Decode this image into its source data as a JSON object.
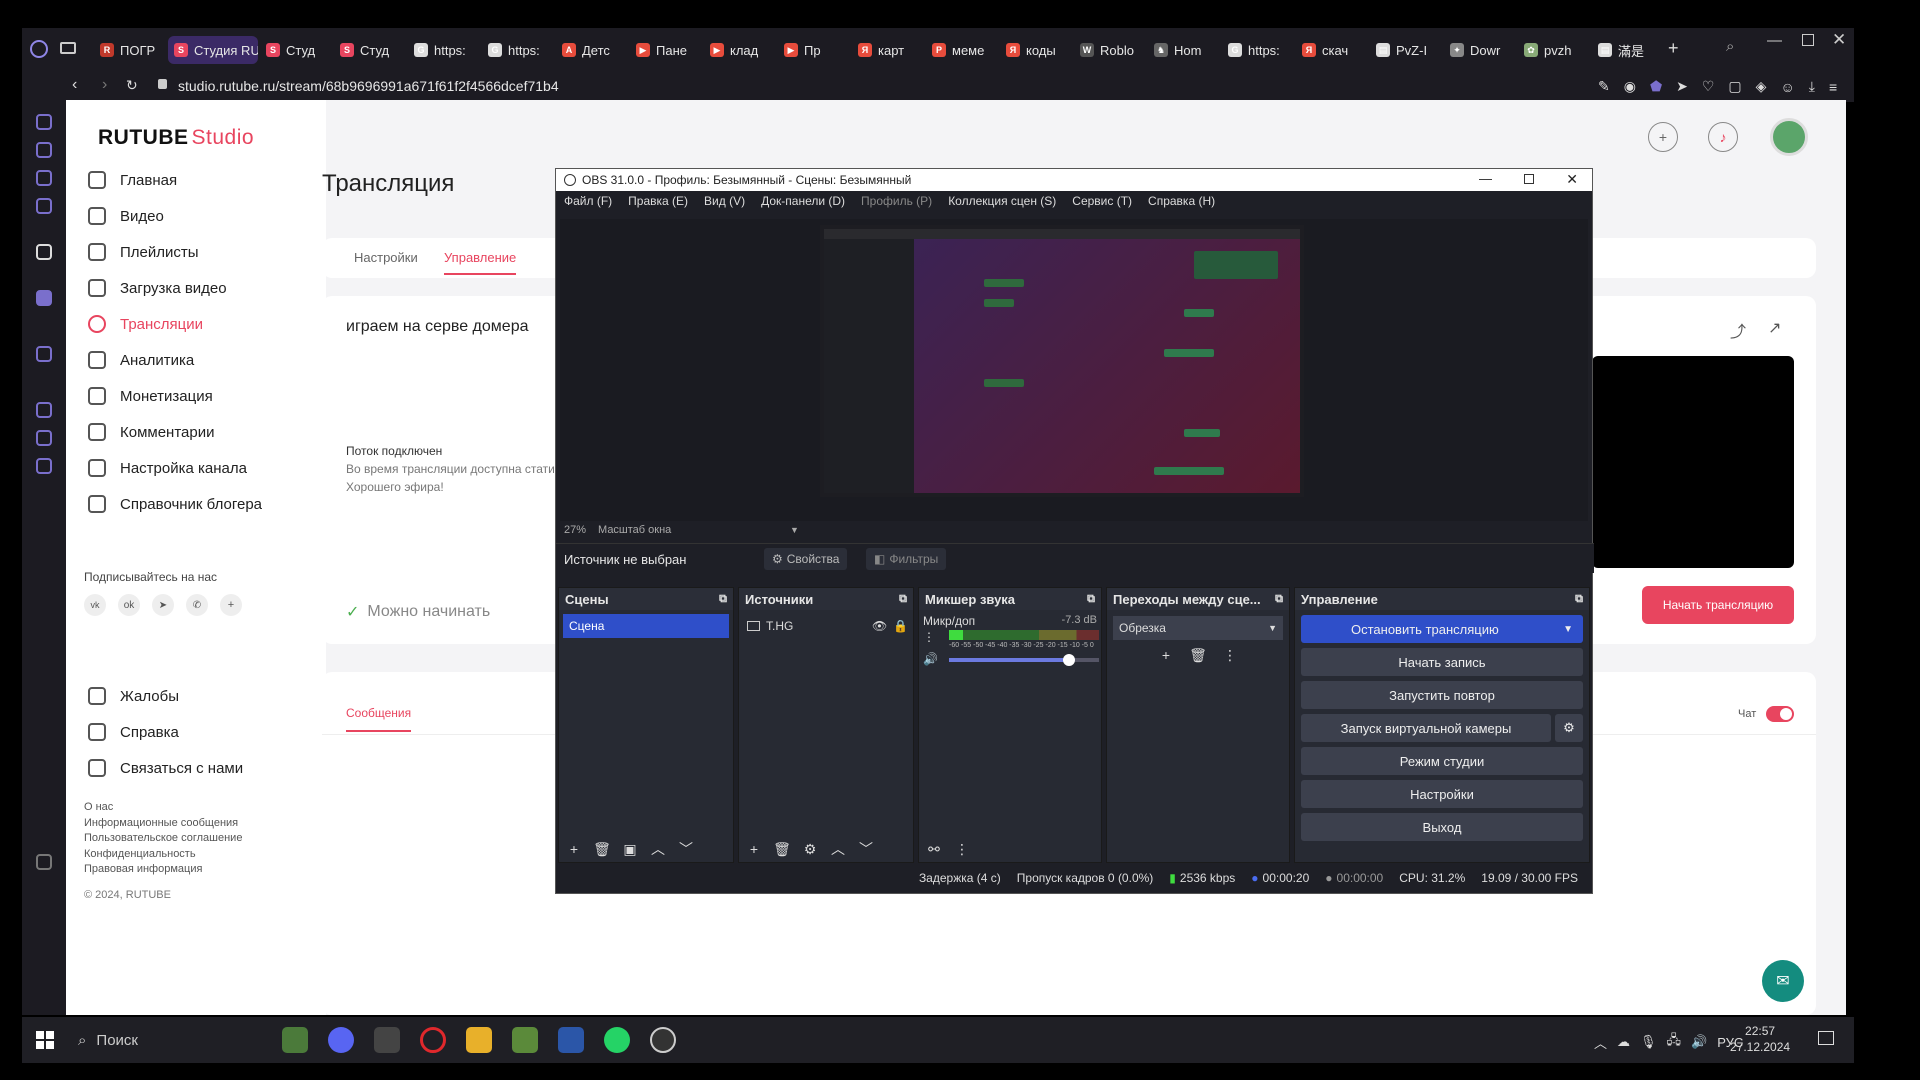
{
  "browser": {
    "tabs": [
      {
        "label": "ПОГР",
        "color": "#c0392b",
        "glyph": "R"
      },
      {
        "label": "Студия RU",
        "color": "#e8455f",
        "glyph": "S",
        "active": true
      },
      {
        "label": "Студ",
        "color": "#e8455f",
        "glyph": "S"
      },
      {
        "label": "Студ",
        "color": "#e8455f",
        "glyph": "S"
      },
      {
        "label": "https:",
        "color": "#ddd",
        "glyph": "G"
      },
      {
        "label": "https:",
        "color": "#ddd",
        "glyph": "G"
      },
      {
        "label": "Детс",
        "color": "#e74c3c",
        "glyph": "A"
      },
      {
        "label": "Пане",
        "color": "#e74c3c",
        "glyph": "▶"
      },
      {
        "label": "клад",
        "color": "#e74c3c",
        "glyph": "▶"
      },
      {
        "label": "Пр",
        "color": "#e74c3c",
        "glyph": "▶"
      },
      {
        "label": "карт",
        "color": "#e74c3c",
        "glyph": "Я"
      },
      {
        "label": "меме",
        "color": "#e74c3c",
        "glyph": "P"
      },
      {
        "label": "коды",
        "color": "#e74c3c",
        "glyph": "Я"
      },
      {
        "label": "Roblo",
        "color": "#555",
        "glyph": "W"
      },
      {
        "label": "Hom",
        "color": "#666",
        "glyph": "♞"
      },
      {
        "label": "https:",
        "color": "#ddd",
        "glyph": "G"
      },
      {
        "label": "скач",
        "color": "#e74c3c",
        "glyph": "Я"
      },
      {
        "label": "PvZ-I",
        "color": "#ddd",
        "glyph": "▤"
      },
      {
        "label": "Dowr",
        "color": "#888",
        "glyph": "✦"
      },
      {
        "label": "pvzh",
        "color": "#8a7",
        "glyph": "✿"
      },
      {
        "label": "滿是",
        "color": "#ddd",
        "glyph": "▤"
      }
    ],
    "url": "studio.rutube.ru/stream/68b9696991a671f61f2f4566dcef71b4"
  },
  "rutube": {
    "logo": "RUTUBE",
    "logo_studio": "Studio",
    "nav": [
      {
        "label": "Главная",
        "name": "home"
      },
      {
        "label": "Видео",
        "name": "video"
      },
      {
        "label": "Плейлисты",
        "name": "playlists"
      },
      {
        "label": "Загрузка видео",
        "name": "upload"
      },
      {
        "label": "Трансляции",
        "name": "streams",
        "active": true
      },
      {
        "label": "Аналитика",
        "name": "analytics"
      },
      {
        "label": "Монетизация",
        "name": "monetization"
      },
      {
        "label": "Комментарии",
        "name": "comments"
      },
      {
        "label": "Настройка канала",
        "name": "channel-settings"
      },
      {
        "label": "Справочник блогера",
        "name": "blogger-guide"
      }
    ],
    "follow_title": "Подписывайтесь на нас",
    "nav2": [
      {
        "label": "Жалобы",
        "name": "complaints"
      },
      {
        "label": "Справка",
        "name": "help"
      },
      {
        "label": "Связаться с нами",
        "name": "contact"
      }
    ],
    "footer_links": [
      "О нас",
      "Информационные сообщения",
      "Пользовательское соглашение",
      "Конфиденциальность",
      "Правовая информация"
    ],
    "copyright": "© 2024, RUTUBE",
    "page_title": "Трансляция",
    "tabs": [
      "Настройки",
      "Управление"
    ],
    "stream_title": "играем на серве домера",
    "stream_status": "Поток подключен",
    "stream_hint": "Во время трансляции доступна стати",
    "stream_wish": "Хорошего эфира!",
    "ready": "Можно начинать",
    "start_button": "Начать трансляцию",
    "messages_tab": "Сообщения",
    "chat_label": "Чат"
  },
  "obs": {
    "title": "OBS 31.0.0 - Профиль: Безымянный - Сцены: Безымянный",
    "menu": [
      "Файл (F)",
      "Правка (E)",
      "Вид (V)",
      "Док-панели (D)",
      "Профиль (P)",
      "Коллекция сцен (S)",
      "Сервис (T)",
      "Справка (H)"
    ],
    "zoom": "27%",
    "zoom_mode": "Масштаб окна",
    "source_none": "Источник не выбран",
    "properties": "Свойства",
    "filters": "Фильтры",
    "scenes_title": "Сцены",
    "scene": "Сцена",
    "sources_title": "Источники",
    "source": "T.HG",
    "mixer_title": "Микшер звука",
    "mic": "Микр/доп",
    "mic_db": "-7.3 dB",
    "mic_scale": "-60 -55 -50 -45 -40 -35 -30 -25 -20 -15 -10 -5 0",
    "mic_level": 0.8,
    "transitions_title": "Переходы между сце...",
    "transition": "Обрезка",
    "controls_title": "Управление",
    "controls": [
      "Остановить трансляцию",
      "Начать запись",
      "Запустить повтор",
      "Запуск виртуальной камеры",
      "Режим студии",
      "Настройки",
      "Выход"
    ],
    "status": {
      "delay": "Задержка (4 с)",
      "dropped": "Пропуск кадров 0 (0.0%)",
      "kbps": "2536 kbps",
      "live_time": "00:00:20",
      "rec_time": "00:00:00",
      "cpu": "CPU: 31.2%",
      "fps": "19.09 / 30.00 FPS"
    }
  },
  "taskbar": {
    "search": "Поиск",
    "lang": "РУС",
    "time": "22:57",
    "date": "27.12.2024"
  }
}
